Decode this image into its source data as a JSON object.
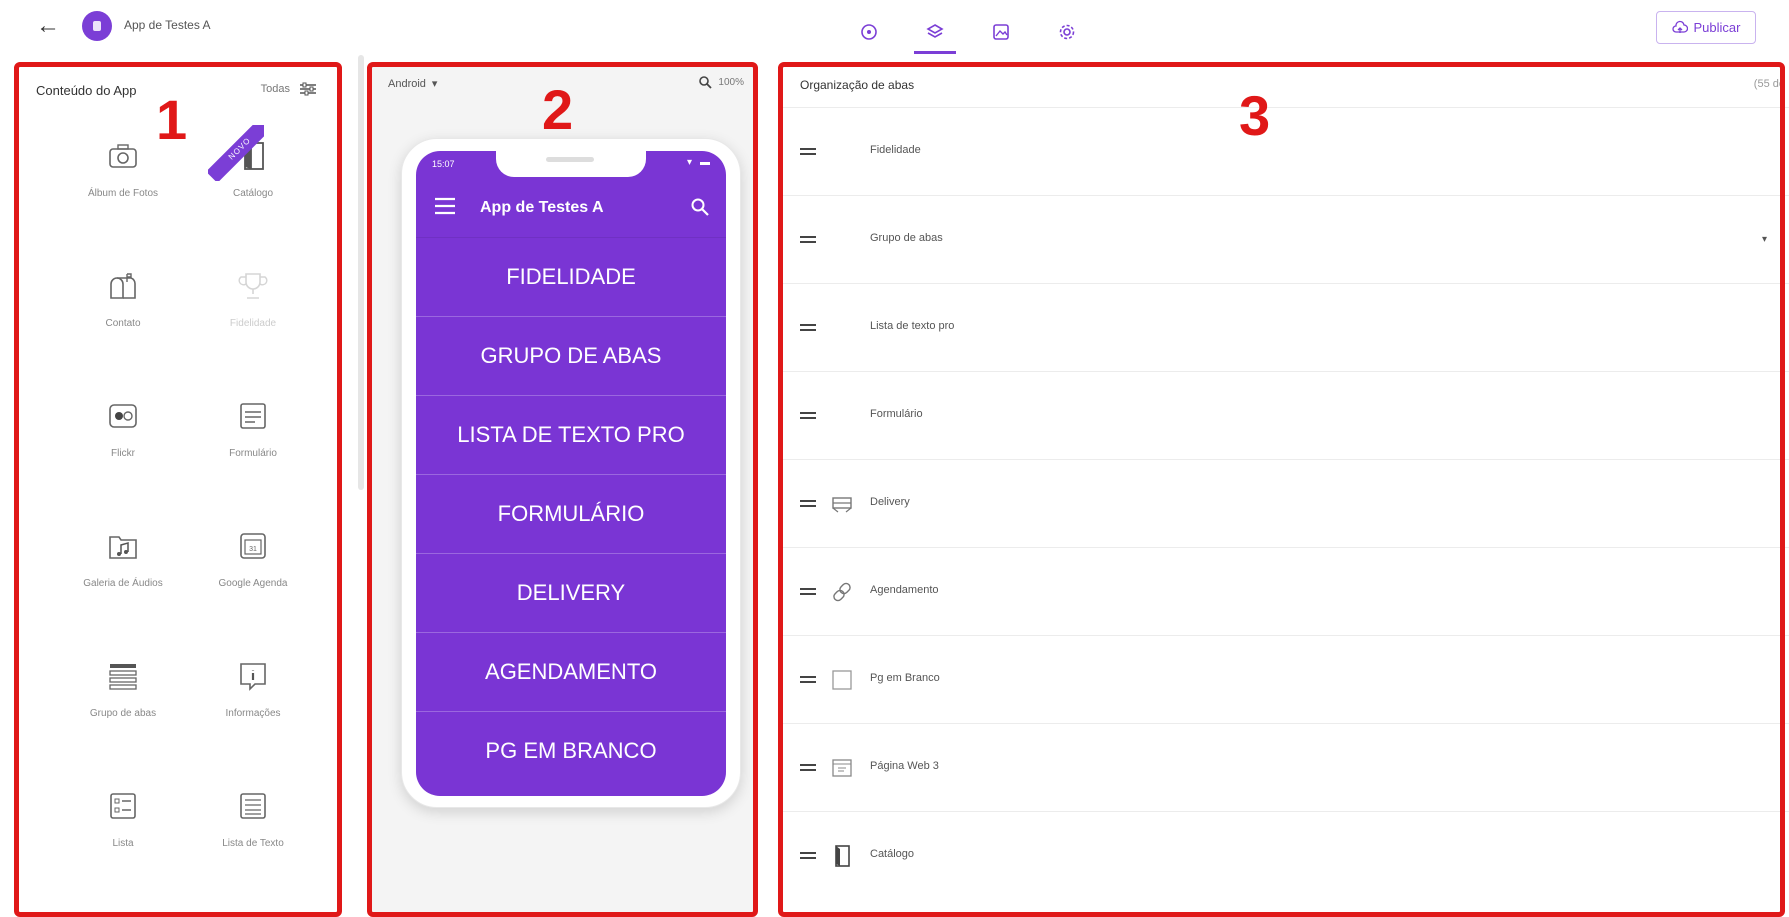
{
  "header": {
    "back_icon": "arrow-left-icon",
    "app_name": "App de Testes A",
    "tabs": [
      {
        "icon": "info-icon",
        "active": false
      },
      {
        "icon": "layers-icon",
        "active": true
      },
      {
        "icon": "image-icon",
        "active": false
      },
      {
        "icon": "gear-icon",
        "active": false
      }
    ],
    "publish_label": "Publicar"
  },
  "markers": {
    "one": "1",
    "two": "2",
    "three": "3"
  },
  "colors": {
    "accent": "#7b3ed6",
    "phone_bg": "#7a35d4",
    "highlight": "#e01818"
  },
  "content_panel": {
    "title": "Conteúdo do App",
    "filter_label": "Todas",
    "tiles": [
      {
        "label": "Álbum de Fotos",
        "icon": "camera-icon",
        "disabled": false,
        "badge": ""
      },
      {
        "label": "Catálogo",
        "icon": "catalog-book-icon",
        "disabled": false,
        "badge": "NOVO"
      },
      {
        "label": "Contato",
        "icon": "mailbox-icon",
        "disabled": false,
        "badge": ""
      },
      {
        "label": "Fidelidade",
        "icon": "trophy-icon",
        "disabled": true,
        "badge": ""
      },
      {
        "label": "Flickr",
        "icon": "flickr-icon",
        "disabled": false,
        "badge": ""
      },
      {
        "label": "Formulário",
        "icon": "form-icon",
        "disabled": false,
        "badge": ""
      },
      {
        "label": "Galeria de Áudios",
        "icon": "audio-folder-icon",
        "disabled": false,
        "badge": ""
      },
      {
        "label": "Google Agenda",
        "icon": "calendar-icon",
        "disabled": false,
        "badge": ""
      },
      {
        "label": "Grupo de abas",
        "icon": "tab-group-icon",
        "disabled": false,
        "badge": ""
      },
      {
        "label": "Informações",
        "icon": "info-bubble-icon",
        "disabled": false,
        "badge": ""
      },
      {
        "label": "Lista",
        "icon": "list-icon",
        "disabled": false,
        "badge": ""
      },
      {
        "label": "Lista de Texto",
        "icon": "text-list-icon",
        "disabled": false,
        "badge": ""
      }
    ]
  },
  "preview": {
    "platform": "Android",
    "zoom": "100%",
    "status_time": "15:07",
    "app_title": "App de Testes A",
    "menu_items": [
      "FIDELIDADE",
      "GRUPO DE ABAS",
      "LISTA DE TEXTO PRO",
      "FORMULÁRIO",
      "DELIVERY",
      "AGENDAMENTO",
      "PG EM BRANCO"
    ]
  },
  "organizer": {
    "title": "Organização de abas",
    "count": "(55 de",
    "rows": [
      {
        "label": "Fidelidade",
        "icon": "",
        "expandable": false
      },
      {
        "label": "Grupo de abas",
        "icon": "",
        "expandable": true
      },
      {
        "label": "Lista de texto pro",
        "icon": "",
        "expandable": false
      },
      {
        "label": "Formulário",
        "icon": "",
        "expandable": false
      },
      {
        "label": "Delivery",
        "icon": "delivery-icon",
        "expandable": false
      },
      {
        "label": "Agendamento",
        "icon": "link-icon",
        "expandable": false
      },
      {
        "label": "Pg em Branco",
        "icon": "blank-page-icon",
        "expandable": false
      },
      {
        "label": "Página Web 3",
        "icon": "web-page-icon",
        "expandable": false
      },
      {
        "label": "Catálogo",
        "icon": "catalog-book-icon",
        "expandable": false
      }
    ]
  }
}
